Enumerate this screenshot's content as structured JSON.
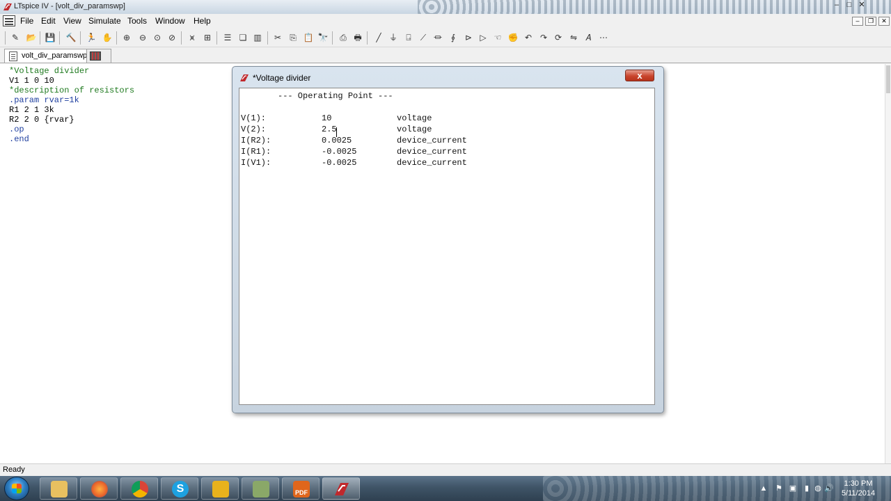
{
  "window": {
    "title": "LTspice IV - [volt_div_paramswp]",
    "controls": [
      "–",
      "□",
      "✕"
    ]
  },
  "menu": {
    "items": [
      "File",
      "Edit",
      "View",
      "Simulate",
      "Tools",
      "Window",
      "Help"
    ],
    "mdi_controls": [
      "–",
      "❐",
      "✕"
    ]
  },
  "toolbar": {
    "icons": [
      "open-schematic-icon",
      "open-file-icon",
      "save-icon",
      "control-panel-icon",
      "run-icon",
      "halt-icon",
      "zoom-in-icon",
      "zoom-out-icon",
      "zoom-fit-icon",
      "zoom-cancel-icon",
      "autorange-icon",
      "autoscale-icon",
      "tile-horizontal-icon",
      "cascade-icon",
      "tile-vertical-icon",
      "cut-icon",
      "copy-icon",
      "paste-icon",
      "find-icon",
      "print-preview-icon",
      "print-icon",
      "wire-icon",
      "ground-icon",
      "label-net-icon",
      "capacitor-icon",
      "resistor-icon",
      "inductor-icon",
      "diode-icon",
      "component-icon",
      "move-icon",
      "drag-icon",
      "undo-icon",
      "redo-icon",
      "rotate-icon",
      "mirror-icon",
      "text-icon",
      "spice-directive-icon"
    ]
  },
  "tabs": [
    {
      "label": "volt_div_paramswp",
      "active": true
    },
    {
      "label": "",
      "active": false,
      "kind": "plot"
    }
  ],
  "netlist": {
    "lines": [
      {
        "text": "*Voltage divider",
        "color": "#1f7a1f"
      },
      {
        "text": "V1 1 0 10",
        "color": "#000000"
      },
      {
        "text": "*description of resistors",
        "color": "#1f7a1f"
      },
      {
        "text": ".param rvar=1k",
        "color": "#1f3f9f"
      },
      {
        "text": "R1 2 1 3k",
        "color": "#000000"
      },
      {
        "text": "R2 2 0 {rvar}",
        "color": "#000000"
      },
      {
        "text": ".op",
        "color": "#1f3f9f"
      },
      {
        "text": ".end",
        "color": "#1f3f9f"
      }
    ]
  },
  "output_window": {
    "title": "*Voltage divider",
    "close_label": "x",
    "heading": "--- Operating Point ---",
    "rows": [
      {
        "name": "V(1):",
        "value": "10",
        "kind": "voltage"
      },
      {
        "name": "V(2):",
        "value": "2.5",
        "kind": "voltage"
      },
      {
        "name": "I(R2):",
        "value": "0.0025",
        "kind": "device_current"
      },
      {
        "name": "I(R1):",
        "value": "-0.0025",
        "kind": "device_current"
      },
      {
        "name": "I(V1):",
        "value": "-0.0025",
        "kind": "device_current"
      }
    ]
  },
  "status": {
    "text": "Ready"
  },
  "taskbar": {
    "apps": [
      {
        "name": "explorer",
        "color": "#e8c060"
      },
      {
        "name": "firefox",
        "color": "#e8622a"
      },
      {
        "name": "chrome",
        "color": "#4a9a3a"
      },
      {
        "name": "skype",
        "color": "#1da1e0"
      },
      {
        "name": "app-yellow",
        "color": "#e8b21c"
      },
      {
        "name": "app-green",
        "color": "#8aa868"
      },
      {
        "name": "pdf",
        "color": "#e0661c",
        "label": "PDF"
      },
      {
        "name": "ltspice",
        "color": "#c0282c",
        "active": true
      }
    ],
    "tray": [
      "▲",
      "⚑",
      "▣",
      "▮",
      "◍",
      "🔊"
    ],
    "clock": {
      "time": "1:30 PM",
      "date": "5/11/2014"
    }
  }
}
